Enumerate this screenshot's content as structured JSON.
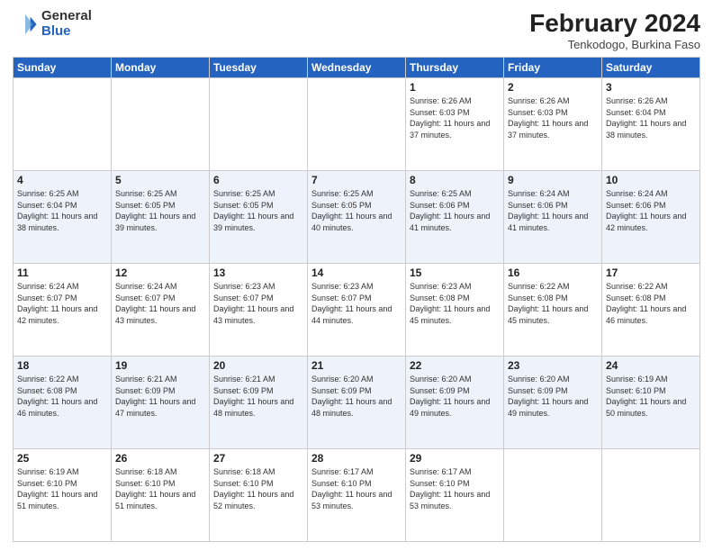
{
  "header": {
    "logo": {
      "general": "General",
      "blue": "Blue"
    },
    "month": "February 2024",
    "location": "Tenkodogo, Burkina Faso"
  },
  "days_of_week": [
    "Sunday",
    "Monday",
    "Tuesday",
    "Wednesday",
    "Thursday",
    "Friday",
    "Saturday"
  ],
  "weeks": [
    [
      {
        "day": "",
        "info": ""
      },
      {
        "day": "",
        "info": ""
      },
      {
        "day": "",
        "info": ""
      },
      {
        "day": "",
        "info": ""
      },
      {
        "day": "1",
        "info": "Sunrise: 6:26 AM\nSunset: 6:03 PM\nDaylight: 11 hours\nand 37 minutes."
      },
      {
        "day": "2",
        "info": "Sunrise: 6:26 AM\nSunset: 6:03 PM\nDaylight: 11 hours\nand 37 minutes."
      },
      {
        "day": "3",
        "info": "Sunrise: 6:26 AM\nSunset: 6:04 PM\nDaylight: 11 hours\nand 38 minutes."
      }
    ],
    [
      {
        "day": "4",
        "info": "Sunrise: 6:25 AM\nSunset: 6:04 PM\nDaylight: 11 hours\nand 38 minutes."
      },
      {
        "day": "5",
        "info": "Sunrise: 6:25 AM\nSunset: 6:05 PM\nDaylight: 11 hours\nand 39 minutes."
      },
      {
        "day": "6",
        "info": "Sunrise: 6:25 AM\nSunset: 6:05 PM\nDaylight: 11 hours\nand 39 minutes."
      },
      {
        "day": "7",
        "info": "Sunrise: 6:25 AM\nSunset: 6:05 PM\nDaylight: 11 hours\nand 40 minutes."
      },
      {
        "day": "8",
        "info": "Sunrise: 6:25 AM\nSunset: 6:06 PM\nDaylight: 11 hours\nand 41 minutes."
      },
      {
        "day": "9",
        "info": "Sunrise: 6:24 AM\nSunset: 6:06 PM\nDaylight: 11 hours\nand 41 minutes."
      },
      {
        "day": "10",
        "info": "Sunrise: 6:24 AM\nSunset: 6:06 PM\nDaylight: 11 hours\nand 42 minutes."
      }
    ],
    [
      {
        "day": "11",
        "info": "Sunrise: 6:24 AM\nSunset: 6:07 PM\nDaylight: 11 hours\nand 42 minutes."
      },
      {
        "day": "12",
        "info": "Sunrise: 6:24 AM\nSunset: 6:07 PM\nDaylight: 11 hours\nand 43 minutes."
      },
      {
        "day": "13",
        "info": "Sunrise: 6:23 AM\nSunset: 6:07 PM\nDaylight: 11 hours\nand 43 minutes."
      },
      {
        "day": "14",
        "info": "Sunrise: 6:23 AM\nSunset: 6:07 PM\nDaylight: 11 hours\nand 44 minutes."
      },
      {
        "day": "15",
        "info": "Sunrise: 6:23 AM\nSunset: 6:08 PM\nDaylight: 11 hours\nand 45 minutes."
      },
      {
        "day": "16",
        "info": "Sunrise: 6:22 AM\nSunset: 6:08 PM\nDaylight: 11 hours\nand 45 minutes."
      },
      {
        "day": "17",
        "info": "Sunrise: 6:22 AM\nSunset: 6:08 PM\nDaylight: 11 hours\nand 46 minutes."
      }
    ],
    [
      {
        "day": "18",
        "info": "Sunrise: 6:22 AM\nSunset: 6:08 PM\nDaylight: 11 hours\nand 46 minutes."
      },
      {
        "day": "19",
        "info": "Sunrise: 6:21 AM\nSunset: 6:09 PM\nDaylight: 11 hours\nand 47 minutes."
      },
      {
        "day": "20",
        "info": "Sunrise: 6:21 AM\nSunset: 6:09 PM\nDaylight: 11 hours\nand 48 minutes."
      },
      {
        "day": "21",
        "info": "Sunrise: 6:20 AM\nSunset: 6:09 PM\nDaylight: 11 hours\nand 48 minutes."
      },
      {
        "day": "22",
        "info": "Sunrise: 6:20 AM\nSunset: 6:09 PM\nDaylight: 11 hours\nand 49 minutes."
      },
      {
        "day": "23",
        "info": "Sunrise: 6:20 AM\nSunset: 6:09 PM\nDaylight: 11 hours\nand 49 minutes."
      },
      {
        "day": "24",
        "info": "Sunrise: 6:19 AM\nSunset: 6:10 PM\nDaylight: 11 hours\nand 50 minutes."
      }
    ],
    [
      {
        "day": "25",
        "info": "Sunrise: 6:19 AM\nSunset: 6:10 PM\nDaylight: 11 hours\nand 51 minutes."
      },
      {
        "day": "26",
        "info": "Sunrise: 6:18 AM\nSunset: 6:10 PM\nDaylight: 11 hours\nand 51 minutes."
      },
      {
        "day": "27",
        "info": "Sunrise: 6:18 AM\nSunset: 6:10 PM\nDaylight: 11 hours\nand 52 minutes."
      },
      {
        "day": "28",
        "info": "Sunrise: 6:17 AM\nSunset: 6:10 PM\nDaylight: 11 hours\nand 53 minutes."
      },
      {
        "day": "29",
        "info": "Sunrise: 6:17 AM\nSunset: 6:10 PM\nDaylight: 11 hours\nand 53 minutes."
      },
      {
        "day": "",
        "info": ""
      },
      {
        "day": "",
        "info": ""
      }
    ]
  ]
}
